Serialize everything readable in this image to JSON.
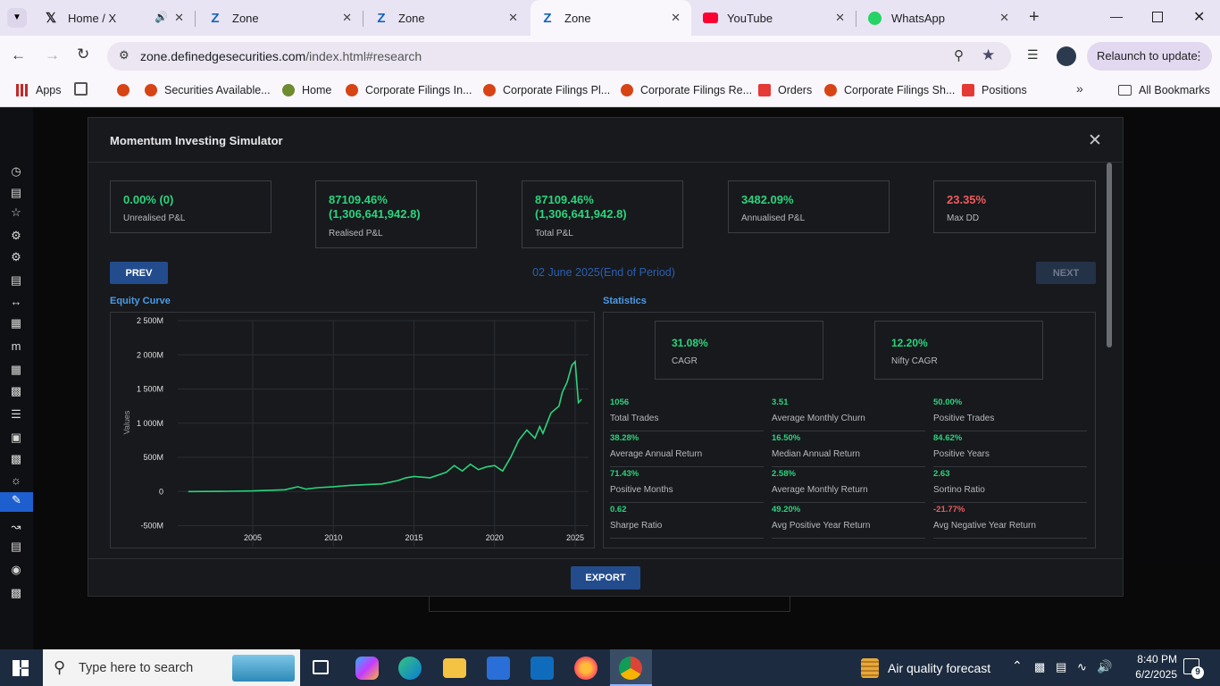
{
  "browser": {
    "tabs": [
      {
        "title": "Home / X",
        "icon": "x-logo-icon"
      },
      {
        "title": "Zone",
        "icon": "zone-icon"
      },
      {
        "title": "Zone",
        "icon": "zone-icon"
      },
      {
        "title": "Zone",
        "icon": "zone-icon",
        "active": true
      },
      {
        "title": "YouTube",
        "icon": "youtube-icon"
      },
      {
        "title": "WhatsApp",
        "icon": "whatsapp-icon"
      }
    ],
    "url_host": "zone.definedgesecurities.com",
    "url_path": "/index.html#research",
    "relaunch_label": "Relaunch to update",
    "bookmarks": [
      "Apps",
      "Securities Available...",
      "Home",
      "Corporate Filings In...",
      "Corporate Filings Pl...",
      "Corporate Filings Re...",
      "Orders",
      "Corporate Filings Sh...",
      "Positions"
    ],
    "all_bookmarks_label": "All Bookmarks"
  },
  "modal": {
    "title": "Momentum Investing Simulator",
    "summary": [
      {
        "value": "0.00% (0)",
        "label": "Unrealised P&L"
      },
      {
        "value": "87109.46%\n(1,306,641,942.8)",
        "label": "Realised P&L"
      },
      {
        "value": "87109.46%\n(1,306,641,942.8)",
        "label": "Total P&L"
      },
      {
        "value": "3482.09%",
        "label": "Annualised P&L"
      },
      {
        "value": "23.35%",
        "label": "Max DD"
      }
    ],
    "prev_label": "PREV",
    "next_label": "NEXT",
    "period_label": "02 June 2025(End of Period)",
    "equity_title": "Equity Curve",
    "stats_title": "Statistics",
    "cagr": {
      "value": "31.08%",
      "label": "CAGR"
    },
    "nifty_cagr": {
      "value": "12.20%",
      "label": "Nifty CAGR"
    },
    "stats": [
      {
        "value": "1056",
        "label": "Total Trades"
      },
      {
        "value": "3.51",
        "label": "Average Monthly Churn"
      },
      {
        "value": "50.00%",
        "label": "Positive Trades"
      },
      {
        "value": "38.28%",
        "label": "Average Annual Return"
      },
      {
        "value": "16.50%",
        "label": "Median Annual Return"
      },
      {
        "value": "84.62%",
        "label": "Positive Years"
      },
      {
        "value": "71.43%",
        "label": "Positive Months"
      },
      {
        "value": "2.58%",
        "label": "Average Monthly Return"
      },
      {
        "value": "2.63",
        "label": "Sortino Ratio"
      },
      {
        "value": "0.62",
        "label": "Sharpe Ratio"
      },
      {
        "value": "49.20%",
        "label": "Avg Positive Year Return"
      },
      {
        "value": "-21.77%",
        "label": "Avg Negative Year Return"
      }
    ],
    "export_label": "EXPORT"
  },
  "chart_data": {
    "type": "line",
    "ylabel": "Values",
    "yticks": [
      "2 500M",
      "2 000M",
      "1 500M",
      "1 000M",
      "500M",
      "0",
      "-500M"
    ],
    "ytick_values": [
      2500,
      2000,
      1500,
      1000,
      500,
      0,
      -500
    ],
    "xticks": [
      "2005",
      "2010",
      "2015",
      "2020",
      "2025"
    ],
    "xtick_values": [
      2005,
      2010,
      2015,
      2020,
      2025
    ],
    "ylim": [
      -500,
      2500
    ],
    "line_color": "#2bd47c",
    "series": [
      {
        "x": [
          2001,
          2003,
          2005,
          2007,
          2007.8,
          2008.3,
          2009,
          2010,
          2011,
          2012,
          2013,
          2014,
          2014.5,
          2015,
          2016,
          2017,
          2017.5,
          2018,
          2018.5,
          2019,
          2019.5,
          2020,
          2020.5,
          2021,
          2021.5,
          2022,
          2022.5,
          2022.8,
          2023,
          2023.5,
          2024,
          2024.2,
          2024.5,
          2024.8,
          2025,
          2025.2,
          2025.4
        ],
        "y": [
          0,
          2,
          8,
          25,
          70,
          35,
          55,
          70,
          90,
          100,
          110,
          160,
          200,
          220,
          200,
          280,
          380,
          300,
          400,
          320,
          360,
          380,
          300,
          500,
          750,
          900,
          780,
          950,
          850,
          1150,
          1250,
          1450,
          1600,
          1850,
          1900,
          1300,
          1350
        ]
      }
    ]
  },
  "taskbar": {
    "search_placeholder": "Type here to search",
    "weather": "Air quality forecast",
    "time": "8:40 PM",
    "date": "6/2/2025",
    "notif_count": "9"
  }
}
